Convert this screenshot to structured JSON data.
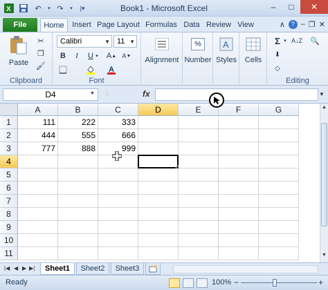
{
  "window": {
    "title": "Book1 - Microsoft Excel",
    "min": "–",
    "max": "□",
    "close": "✕"
  },
  "qat": {
    "app_icon": "excel-icon",
    "save_icon": "save-icon",
    "undo_icon": "undo-icon",
    "redo_icon": "redo-icon"
  },
  "tabs": {
    "file": "File",
    "items": [
      "Home",
      "Insert",
      "Page Layout",
      "Formulas",
      "Data",
      "Review",
      "View"
    ]
  },
  "ribbon": {
    "clipboard": {
      "label": "Clipboard",
      "paste": "Paste"
    },
    "font": {
      "label": "Font",
      "font_name": "Calibri",
      "font_size": "11"
    },
    "alignment": {
      "label": "Alignment"
    },
    "number": {
      "label": "Number"
    },
    "styles": {
      "label": "Styles"
    },
    "cells": {
      "label": "Cells"
    },
    "editing": {
      "label": "Editing"
    }
  },
  "formula_bar": {
    "name_box": "D4",
    "fx": "fx",
    "value": ""
  },
  "grid": {
    "columns": [
      "A",
      "B",
      "C",
      "D",
      "E",
      "F",
      "G"
    ],
    "rows": [
      "1",
      "2",
      "3",
      "4",
      "5",
      "6",
      "7",
      "8",
      "9",
      "10",
      "11"
    ],
    "cells": {
      "A1": "111",
      "B1": "222",
      "C1": "333",
      "A2": "444",
      "B2": "555",
      "C2": "666",
      "A3": "777",
      "B3": "888",
      "C3": "999"
    },
    "selected_column": "D",
    "selected_row": "4"
  },
  "sheets": [
    "Sheet1",
    "Sheet2",
    "Sheet3"
  ],
  "status": {
    "ready": "Ready",
    "zoom": "100%",
    "zoom_minus": "−",
    "zoom_plus": "+"
  },
  "colors": {
    "file_tab": "#2a8a2a",
    "selection": "#f6c95a"
  }
}
